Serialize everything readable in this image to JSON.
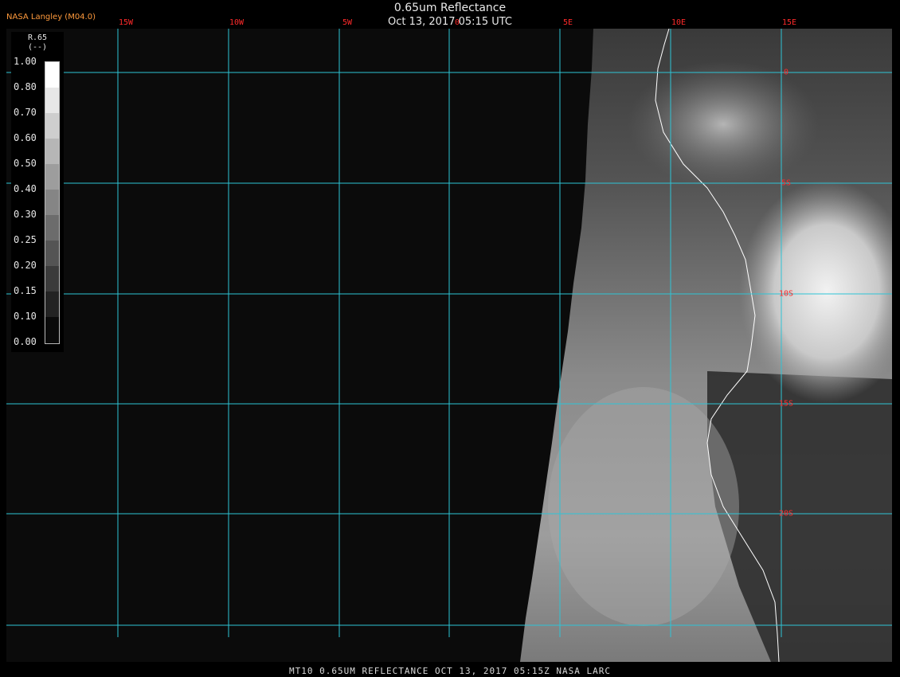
{
  "header": {
    "title": "0.65um Reflectance",
    "timestamp": "Oct 13, 2017 05:15 UTC",
    "producer": "NASA Langley (M04.0)"
  },
  "footer": {
    "caption": "MT10  0.65UM REFLECTANCE   OCT 13, 2017 05:15Z   NASA LARC"
  },
  "grid": {
    "longitudes": [
      "15W",
      "10W",
      "5W",
      "0",
      "5E",
      "10E",
      "15E"
    ],
    "latitudes": [
      "0",
      "5S",
      "10S",
      "15S",
      "20S"
    ],
    "line_color": "#2ec4d6",
    "label_color": "#ff2a2a"
  },
  "legend": {
    "title": "R.65",
    "units": "(--)",
    "ticks": [
      "1.00",
      "0.80",
      "0.70",
      "0.60",
      "0.50",
      "0.40",
      "0.30",
      "0.25",
      "0.20",
      "0.15",
      "0.10",
      "0.00"
    ]
  },
  "colors": {
    "space": "#0b0b0b",
    "coastline": "#ffffff"
  }
}
